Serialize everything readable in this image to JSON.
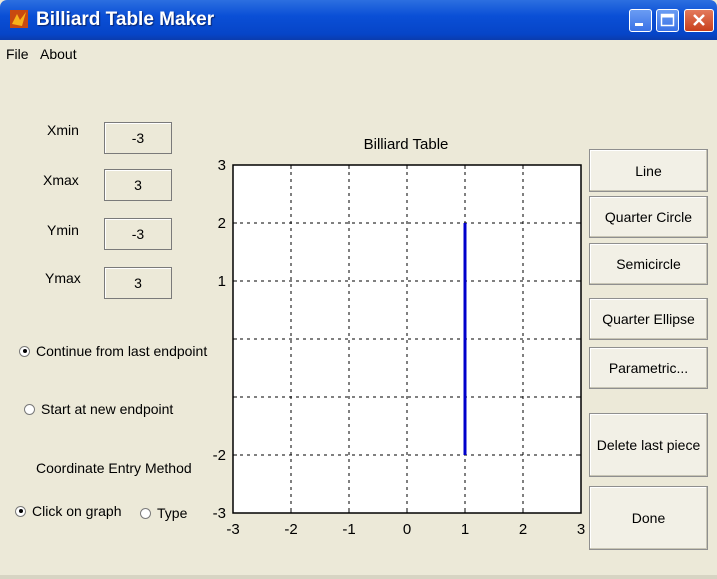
{
  "window": {
    "title": "Billiard Table Maker"
  },
  "menu": {
    "items": [
      "File",
      "About"
    ]
  },
  "limits": {
    "xmin_label": "Xmin",
    "xmin_value": "-3",
    "xmax_label": "Xmax",
    "xmax_value": "3",
    "ymin_label": "Ymin",
    "ymin_value": "-3",
    "ymax_label": "Ymax",
    "ymax_value": "3"
  },
  "start_options": {
    "continue_label": "Continue from last endpoint",
    "continue_selected": true,
    "new_label": "Start at new endpoint",
    "new_selected": false
  },
  "coordinate_entry": {
    "heading": "Coordinate Entry Method",
    "click_label": "Click on graph",
    "click_selected": true,
    "type_label": "Type",
    "type_selected": false
  },
  "buttons": {
    "line": "Line",
    "quarter_circle": "Quarter Circle",
    "semicircle": "Semicircle",
    "quarter_ellipse": "Quarter Ellipse",
    "parametric": "Parametric...",
    "delete_last": "Delete last piece",
    "done": "Done"
  },
  "chart_data": {
    "type": "line",
    "title": "Billiard Table",
    "xlim": [
      -3,
      3
    ],
    "ylim": [
      -3,
      3
    ],
    "xticks": [
      "-3",
      "-2",
      "-1",
      "0",
      "1",
      "2",
      "3"
    ],
    "yticks": [
      "-3",
      "-2",
      "",
      "",
      "1",
      "2",
      "3"
    ],
    "grid": true,
    "series": [
      {
        "x": [
          1,
          1
        ],
        "y": [
          -2,
          2
        ],
        "color": "#0000cc"
      }
    ]
  }
}
